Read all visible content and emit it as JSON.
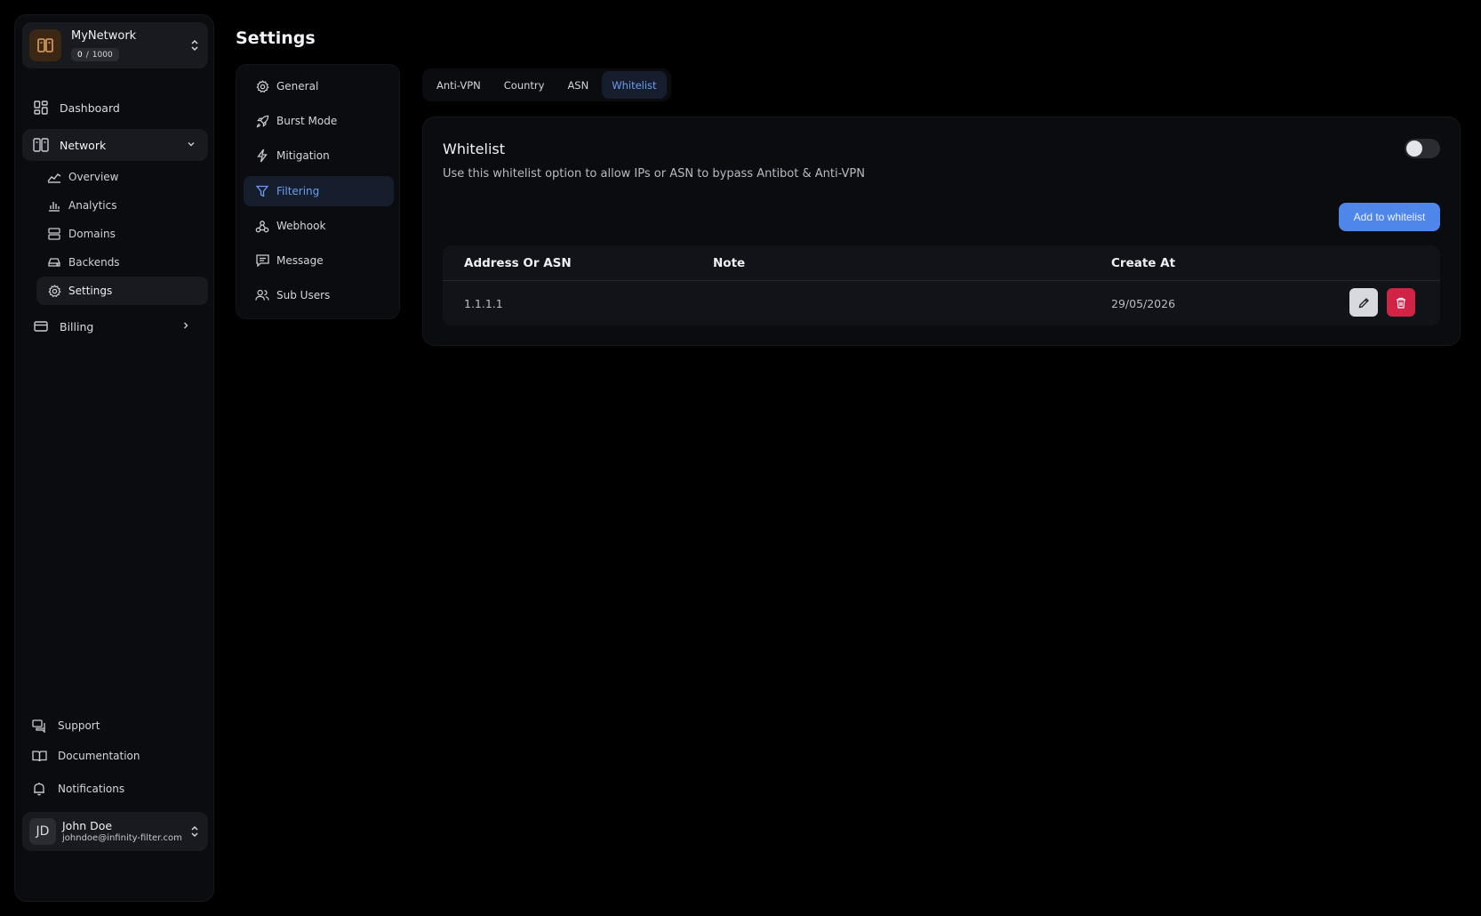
{
  "network": {
    "name": "MyNetwork",
    "quota_used": "0",
    "quota_sep": "/",
    "quota_total": "1000"
  },
  "nav": {
    "dashboard": "Dashboard",
    "network": "Network",
    "sub": {
      "overview": "Overview",
      "analytics": "Analytics",
      "domains": "Domains",
      "backends": "Backends",
      "settings": "Settings"
    },
    "billing": "Billing",
    "support": "Support",
    "documentation": "Documentation",
    "notifications": "Notifications"
  },
  "user": {
    "initials": "JD",
    "name": "John Doe",
    "email": "johndoe@infinity-filter.com"
  },
  "page": {
    "title": "Settings"
  },
  "settings_menu": {
    "general": "General",
    "burst": "Burst Mode",
    "mitigation": "Mitigation",
    "filtering": "Filtering",
    "webhook": "Webhook",
    "message": "Message",
    "subusers": "Sub Users"
  },
  "tabs": [
    "Anti-VPN",
    "Country",
    "ASN",
    "Whitelist"
  ],
  "whitelist": {
    "title": "Whitelist",
    "description": "Use this whitelist option to allow IPs or ASN to bypass Antibot & Anti-VPN",
    "enabled": false,
    "add_button": "Add to whitelist",
    "columns": [
      "Address Or ASN",
      "Note",
      "Create At"
    ],
    "rows": [
      {
        "address": "1.1.1.1",
        "note": "",
        "created": "29/05/2026"
      }
    ]
  },
  "colors": {
    "accent": "#4f86ea",
    "active_text": "#6c9cf0",
    "danger": "#d02446",
    "logo_bg": "#3b2714",
    "logo_fg": "#e0a060"
  }
}
